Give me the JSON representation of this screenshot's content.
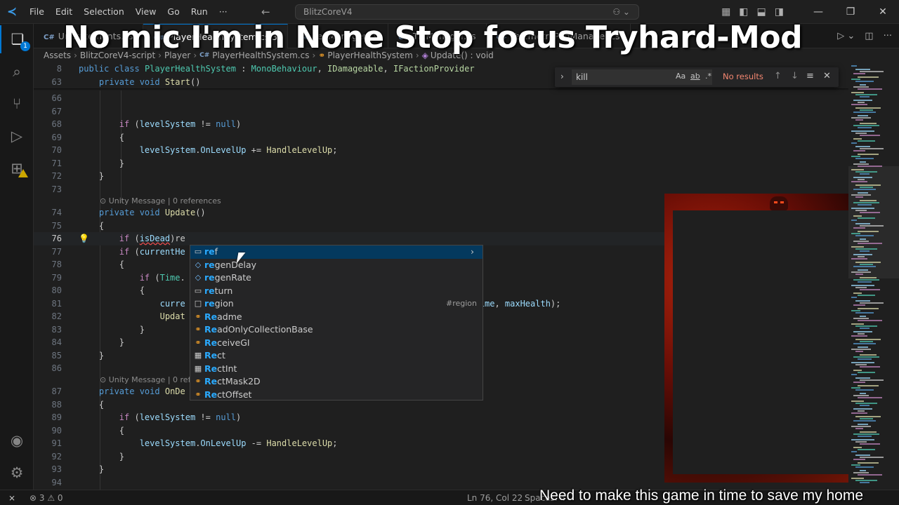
{
  "titlebar": {
    "menu": [
      "File",
      "Edit",
      "Selection",
      "View",
      "Go",
      "Run",
      "···"
    ],
    "search": "BlitzCoreV4"
  },
  "activity_badge": "1",
  "tabs": [
    {
      "label": "Un..tatements.cs",
      "active": false
    },
    {
      "label": "PlayerHealthSystem.cs 3",
      "active": true
    },
    {
      "label": "Le..Manager.cs",
      "active": false
    },
    {
      "label": "Ti..Manager.cs",
      "active": false
    },
    {
      "label": "TelemetryPadManager.cs",
      "active": false
    }
  ],
  "breadcrumb": [
    "Assets",
    "BlitzCoreV4-script",
    "Player",
    "PlayerHealthSystem.cs",
    "PlayerHealthSystem",
    "Update() : void"
  ],
  "find": {
    "query": "kill",
    "match_case": "Aa",
    "whole_word": "ab",
    "regex": ".*",
    "result": "No results"
  },
  "codelens": {
    "update": "Unity Message | 0 references",
    "ondestroy": "Unity Message | 0 refe"
  },
  "suggest": [
    {
      "icon": "keyword",
      "match": "re",
      "rest": "f",
      "detail": ""
    },
    {
      "icon": "field",
      "match": "re",
      "rest": "genDelay",
      "detail": ""
    },
    {
      "icon": "field",
      "match": "re",
      "rest": "genRate",
      "detail": ""
    },
    {
      "icon": "keyword",
      "match": "re",
      "rest": "turn",
      "detail": ""
    },
    {
      "icon": "snippet",
      "match": "re",
      "rest": "gion",
      "detail": "#region"
    },
    {
      "icon": "class",
      "match": "Re",
      "rest": "adme",
      "detail": ""
    },
    {
      "icon": "class",
      "match": "Re",
      "rest": "adOnlyCollectionBase",
      "detail": ""
    },
    {
      "icon": "class",
      "match": "Re",
      "rest": "ceiveGI",
      "detail": ""
    },
    {
      "icon": "struct",
      "match": "Re",
      "rest": "ct",
      "detail": ""
    },
    {
      "icon": "struct",
      "match": "Re",
      "rest": "ctInt",
      "detail": ""
    },
    {
      "icon": "class",
      "match": "Re",
      "rest": "ctMask2D",
      "detail": ""
    },
    {
      "icon": "class",
      "match": "Re",
      "rest": "ctOffset",
      "detail": ""
    }
  ],
  "status": {
    "errors": "⊗ 3 ⚠ 0",
    "position": "Ln 76, Col 22",
    "spaces": "Spaces: 4"
  },
  "overlay": {
    "banner": "No mic I'm in None Stop focus Tryhard-Mod",
    "caption": "Need to make this game in time to save my home"
  },
  "colors": {
    "keyword": "#569cd6",
    "control": "#c586c0",
    "type": "#4ec9b0",
    "method": "#dcdcaa",
    "variable": "#9cdcfe",
    "accent": "#0078d4"
  }
}
